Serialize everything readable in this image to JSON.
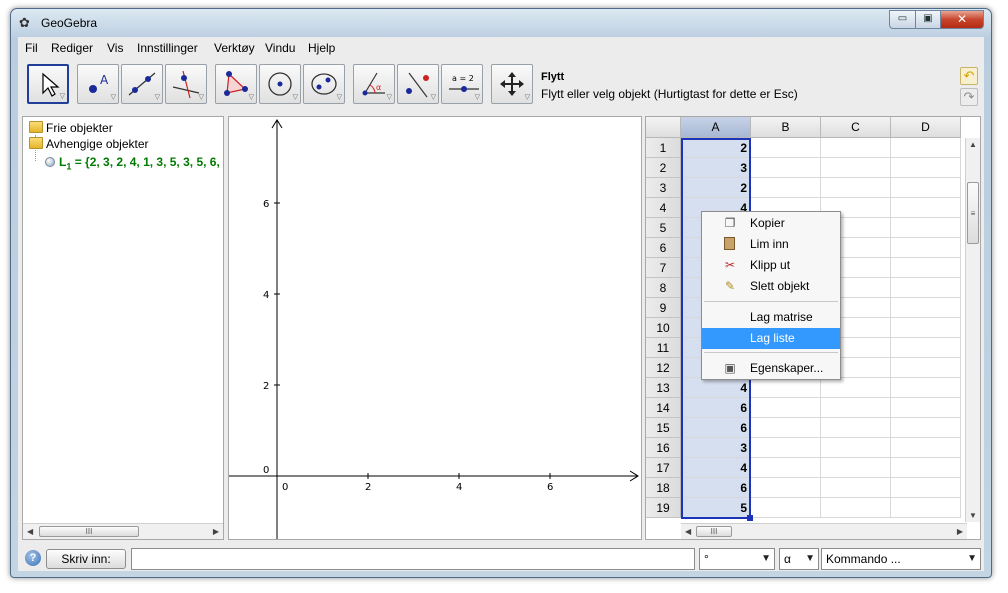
{
  "window": {
    "title": "GeoGebra",
    "app_icon": "✿",
    "min_glyph": "▭",
    "max_glyph": "▣",
    "close_glyph": "✕"
  },
  "menus": [
    "Fil",
    "Rediger",
    "Vis",
    "Innstillinger",
    "Verktøy",
    "Vindu",
    "Hjelp"
  ],
  "toolbar": {
    "active_tool": "Flytt",
    "help_text": "Flytt eller velg objekt (Hurtigtast for dette er Esc)",
    "slider_label": "a = 2",
    "undo_glyph": "↶",
    "redo_glyph": "↷"
  },
  "algebra": {
    "free_label": "Frie objekter",
    "dependent_label": "Avhengige objekter",
    "list_name": "L",
    "list_sub": "1",
    "list_value": " = {2, 3, 2, 4, 1, 3, 5, 3, 5, 6,",
    "scroll_grip": "III"
  },
  "graphics": {
    "x_ticks": [
      "0",
      "2",
      "4",
      "6"
    ],
    "y_ticks": [
      "0",
      "2",
      "4",
      "6"
    ]
  },
  "spreadsheet": {
    "columns": [
      "A",
      "B",
      "C",
      "D"
    ],
    "row_numbers": [
      "1",
      "2",
      "3",
      "4",
      "5",
      "6",
      "7",
      "8",
      "9",
      "10",
      "11",
      "12",
      "13",
      "14",
      "15",
      "16",
      "17",
      "18",
      "19"
    ],
    "col_a_values": [
      "2",
      "3",
      "2",
      "4",
      "",
      "",
      "",
      "",
      "",
      "",
      "",
      "",
      "4",
      "6",
      "6",
      "3",
      "4",
      "6",
      "5"
    ],
    "scroll_grip": "III",
    "vscroll_grip": "≡"
  },
  "context_menu": {
    "items": [
      {
        "label": "Kopier",
        "icon": "copy-icon",
        "glyph": "❐"
      },
      {
        "label": "Lim inn",
        "icon": "paste-icon",
        "glyph": "📋"
      },
      {
        "label": "Klipp ut",
        "icon": "scissors-icon",
        "glyph": "✂"
      },
      {
        "label": "Slett objekt",
        "icon": "eraser-icon",
        "glyph": "✎"
      },
      {
        "label": "Lag matrise",
        "icon": "",
        "glyph": ""
      },
      {
        "label": "Lag liste",
        "icon": "",
        "glyph": "",
        "highlighted": true
      },
      {
        "label": "Egenskaper...",
        "icon": "properties-icon",
        "glyph": "▣"
      }
    ]
  },
  "input_bar": {
    "help_glyph": "?",
    "button_label": "Skriv inn:",
    "input_value": "",
    "degree_value": "°",
    "greek_value": "α",
    "command_value": "Kommando ...",
    "dropdown_glyph": "▼"
  },
  "colors": {
    "selection_border": "#1c34b8",
    "selected_fill": "#d6dff0",
    "highlight": "#3399ff",
    "list_text": "#007a00"
  }
}
